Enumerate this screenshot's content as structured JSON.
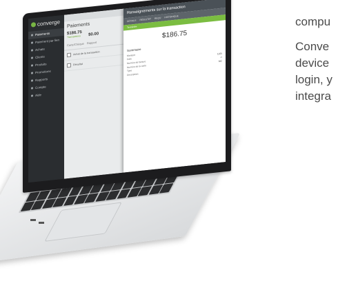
{
  "side_text": {
    "lines_1": [
      "compu"
    ],
    "lines_2": [
      "Conve",
      "device",
      "login, y",
      "integra"
    ]
  },
  "sidebar": {
    "brand": "converge",
    "items": [
      {
        "label": "Paiements",
        "active": true
      },
      {
        "label": "Paiement par lien",
        "active": false
      },
      {
        "label": "Achats",
        "active": false
      },
      {
        "label": "Clients",
        "active": false
      },
      {
        "label": "Produits",
        "active": false
      },
      {
        "label": "Promotions",
        "active": false
      },
      {
        "label": "Rapports",
        "active": false
      },
      {
        "label": "Compte",
        "active": false
      },
      {
        "label": "Aide",
        "active": false
      }
    ]
  },
  "main": {
    "title": "Paiements",
    "stat_amount": "$186.75",
    "stat_amount_label": "Transactions",
    "stat_zero": "$0.00",
    "tabs": [
      "Carte/Chèque",
      "Rapport"
    ],
    "rows": [
      {
        "label": "Achat de la transaction"
      },
      {
        "label": "Résultat"
      }
    ]
  },
  "modal": {
    "title": "Renseignements sur la transaction",
    "tabs": [
      "DÉTAILS",
      "RÉSULTAT",
      "REÇU",
      "HISTORIQUE"
    ],
    "status": "Terminée",
    "amount": "$186.75",
    "section": "Sommaire",
    "fields": [
      {
        "k": "Montant",
        "v": ""
      },
      {
        "k": "Date",
        "v": ""
      },
      {
        "k": "Numéro de facture",
        "v": "1105"
      },
      {
        "k": "Numéro de la carte",
        "v": "**"
      },
      {
        "k": "Type",
        "v": "MC"
      },
      {
        "k": "Description",
        "v": ""
      }
    ]
  },
  "colors": {
    "accent_green": "#7bbd41",
    "sidebar_bg": "#2a2d30",
    "modal_header": "#4a5157"
  }
}
